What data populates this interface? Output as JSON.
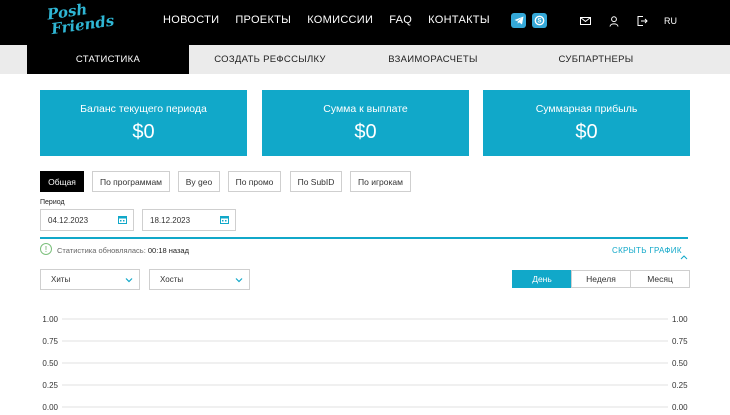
{
  "header": {
    "logo_line1": "Posh",
    "logo_line2": "Friends",
    "nav": [
      "НОВОСТИ",
      "ПРОЕКТЫ",
      "КОМИССИИ",
      "FAQ",
      "КОНТАКТЫ"
    ],
    "lang": "RU",
    "icons": [
      "telegram-icon",
      "skype-icon",
      "mail-icon",
      "user-icon",
      "logout-icon"
    ]
  },
  "tabs": [
    {
      "label": "СТАТИСТИКА",
      "active": true
    },
    {
      "label": "СОЗДАТЬ РЕФССЫЛКУ",
      "active": false
    },
    {
      "label": "ВЗАИМОРАСЧЕТЫ",
      "active": false
    },
    {
      "label": "СУБПАРТНЕРЫ",
      "active": false
    }
  ],
  "cards": [
    {
      "label": "Баланс текущего периода",
      "value": "$0"
    },
    {
      "label": "Сумма к выплате",
      "value": "$0"
    },
    {
      "label": "Суммарная прибыль",
      "value": "$0"
    }
  ],
  "filters": [
    {
      "label": "Общая",
      "active": true
    },
    {
      "label": "По программам",
      "active": false
    },
    {
      "label": "By geo",
      "active": false
    },
    {
      "label": "По промо",
      "active": false
    },
    {
      "label": "По SubID",
      "active": false
    },
    {
      "label": "По игрокам",
      "active": false
    }
  ],
  "period": {
    "label": "Период",
    "from": "04.12.2023",
    "to": "18.12.2023"
  },
  "status": {
    "text": "Статистика обновлялась:",
    "time": "00:18 назад"
  },
  "hide_chart": "СКРЫТЬ ГРАФИК",
  "selects": {
    "metric1": "Хиты",
    "metric2": "Хосты"
  },
  "granularity": [
    {
      "label": "День",
      "active": true
    },
    {
      "label": "Неделя",
      "active": false
    },
    {
      "label": "Месяц",
      "active": false
    }
  ],
  "colors": {
    "accent": "#11a8c9",
    "header_bg": "#000000",
    "tab_bar": "#ebebeb"
  },
  "chart_data": {
    "type": "line",
    "yticks_left": [
      "1.00",
      "0.75",
      "0.50",
      "0.25",
      "0.00"
    ],
    "yticks_right": [
      "1.00",
      "0.75",
      "0.50",
      "0.25",
      "0.00"
    ],
    "ylim": [
      0,
      1
    ],
    "grid": true,
    "series": []
  }
}
